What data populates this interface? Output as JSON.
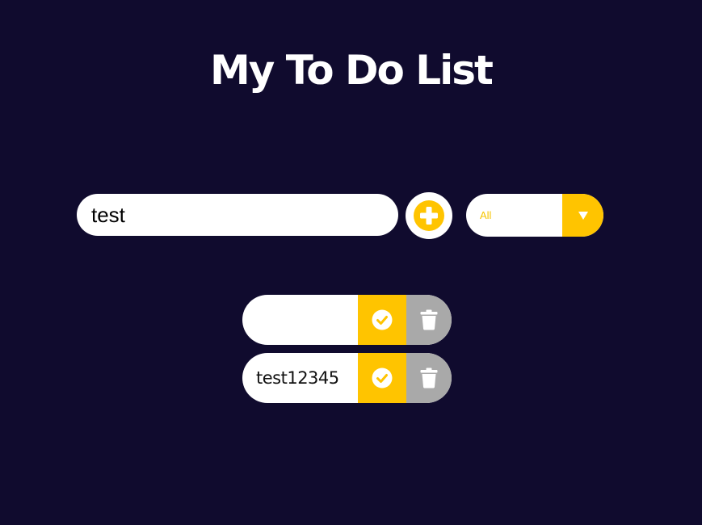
{
  "header": {
    "title": "My To Do List"
  },
  "form": {
    "input_value": "test",
    "add_icon": "plus-circle-icon",
    "filter_selected": "All",
    "filter_arrow_icon": "caret-down-icon"
  },
  "todos": [
    {
      "text": "",
      "complete_icon": "check-circle-icon",
      "delete_icon": "trash-icon"
    },
    {
      "text": "test12345",
      "complete_icon": "check-circle-icon",
      "delete_icon": "trash-icon"
    }
  ],
  "colors": {
    "background": "#100b2e",
    "accent": "#ffc400",
    "delete": "#a9a9a9",
    "surface": "#ffffff"
  }
}
